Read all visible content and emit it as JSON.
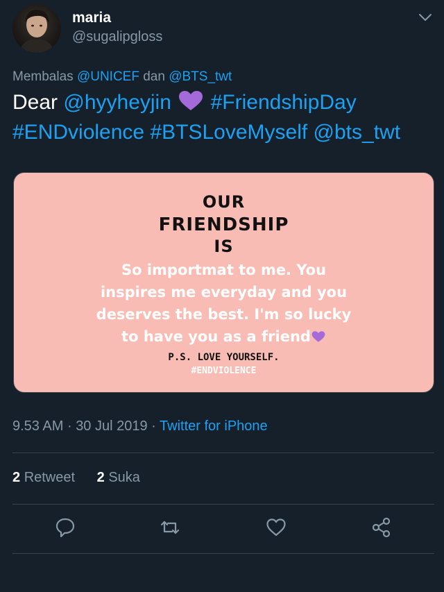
{
  "user": {
    "display_name": "maria",
    "handle": "@sugalipgloss",
    "avatar_icon": "avatar-photo"
  },
  "reply": {
    "prefix": "Membalas",
    "mention_1": "@UNICEF",
    "joiner": "dan",
    "mention_2": "@BTS_twt"
  },
  "tweet": {
    "word_dear": "Dear",
    "mention": "@hyyheyjin",
    "emoji": "purple-heart",
    "hashtag_1": "#FriendshipDay",
    "hashtag_2": "#ENDviolence",
    "hashtag_3": "#BTSLoveMyself",
    "mention_end": "@bts_twt"
  },
  "card": {
    "title_line_1": "OUR",
    "title_line_2": "FRIENDSHIP",
    "title_line_3": "IS",
    "body_line_1": "So importmat to me. You",
    "body_line_2": "inspires me everyday and you",
    "body_line_3": "deserves the best. I'm so lucky",
    "body_line_4": "to have you as a friend",
    "ps": "P.S. LOVE YOURSELF.",
    "tag": "#ENDVIOLENCE",
    "background_color": "#f9bcb4"
  },
  "meta": {
    "time": "9.53 AM",
    "date": "30 Jul 2019",
    "source": "Twitter for iPhone"
  },
  "stats": {
    "retweet_count": "2",
    "retweet_label": "Retweet",
    "like_count": "2",
    "like_label": "Suka"
  },
  "actions": [
    "reply-icon",
    "retweet-icon",
    "like-icon",
    "share-icon"
  ],
  "colors": {
    "background": "#15202b",
    "accent": "#1da1f2",
    "muted": "#8899a6",
    "purple_heart": "#a56ad9"
  }
}
